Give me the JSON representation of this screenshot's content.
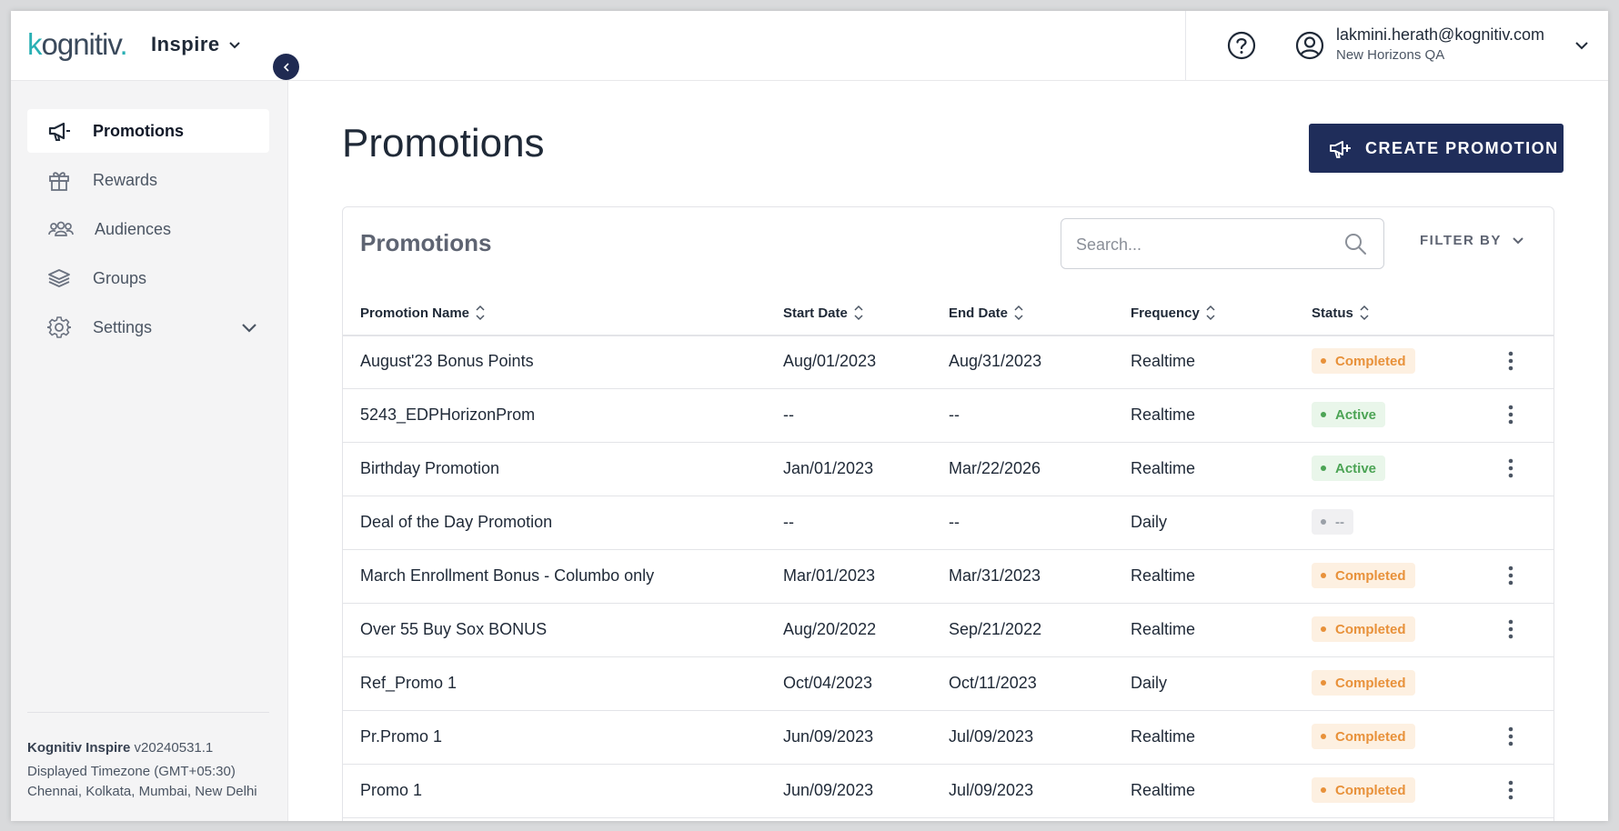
{
  "header": {
    "logo_text": "kognitiv",
    "app_name": "Inspire",
    "user_email": "lakmini.herath@kognitiv.com",
    "user_org": "New Horizons QA"
  },
  "sidebar": {
    "items": [
      {
        "label": "Promotions",
        "icon": "megaphone-icon",
        "active": true
      },
      {
        "label": "Rewards",
        "icon": "gift-icon",
        "active": false
      },
      {
        "label": "Audiences",
        "icon": "people-icon",
        "active": false
      },
      {
        "label": "Groups",
        "icon": "layers-icon",
        "active": false
      },
      {
        "label": "Settings",
        "icon": "gear-icon",
        "active": false
      }
    ],
    "footer": {
      "product": "Kognitiv Inspire",
      "version": "v20240531.1",
      "timezone": "Displayed Timezone (GMT+05:30)",
      "cities": "Chennai, Kolkata, Mumbai, New Delhi"
    }
  },
  "main": {
    "page_title": "Promotions",
    "create_button": "CREATE PROMOTION",
    "card_title": "Promotions",
    "search_placeholder": "Search...",
    "filter_label": "FILTER BY",
    "columns": [
      "Promotion Name",
      "Start Date",
      "End Date",
      "Frequency",
      "Status"
    ],
    "rows": [
      {
        "name": "August'23 Bonus Points",
        "start": "Aug/01/2023",
        "end": "Aug/31/2023",
        "frequency": "Realtime",
        "status": "Completed",
        "status_type": "completed",
        "menu": true
      },
      {
        "name": "5243_EDPHorizonProm",
        "start": "--",
        "end": "--",
        "frequency": "Realtime",
        "status": "Active",
        "status_type": "active",
        "menu": true
      },
      {
        "name": "Birthday Promotion",
        "start": "Jan/01/2023",
        "end": "Mar/22/2026",
        "frequency": "Realtime",
        "status": "Active",
        "status_type": "active",
        "menu": true
      },
      {
        "name": "Deal of the Day Promotion",
        "start": "--",
        "end": "--",
        "frequency": "Daily",
        "status": "--",
        "status_type": "none",
        "menu": false
      },
      {
        "name": "March Enrollment Bonus - Columbo only",
        "start": "Mar/01/2023",
        "end": "Mar/31/2023",
        "frequency": "Realtime",
        "status": "Completed",
        "status_type": "completed",
        "menu": true
      },
      {
        "name": "Over 55 Buy Sox BONUS",
        "start": "Aug/20/2022",
        "end": "Sep/21/2022",
        "frequency": "Realtime",
        "status": "Completed",
        "status_type": "completed",
        "menu": true
      },
      {
        "name": "Ref_Promo 1",
        "start": "Oct/04/2023",
        "end": "Oct/11/2023",
        "frequency": "Daily",
        "status": "Completed",
        "status_type": "completed",
        "menu": false
      },
      {
        "name": "Pr.Promo 1",
        "start": "Jun/09/2023",
        "end": "Jul/09/2023",
        "frequency": "Realtime",
        "status": "Completed",
        "status_type": "completed",
        "menu": true
      },
      {
        "name": "Promo 1",
        "start": "Jun/09/2023",
        "end": "Jul/09/2023",
        "frequency": "Realtime",
        "status": "Completed",
        "status_type": "completed",
        "menu": true
      }
    ]
  },
  "colors": {
    "primary": "#1f2d5a",
    "teal": "#2ab0b4",
    "completed_bg": "#fdf0e1",
    "completed_text": "#e8913a",
    "active_bg": "#e9f6ea",
    "active_text": "#4ca455",
    "none_bg": "#f0f0f2",
    "none_text": "#9aa0a8"
  }
}
